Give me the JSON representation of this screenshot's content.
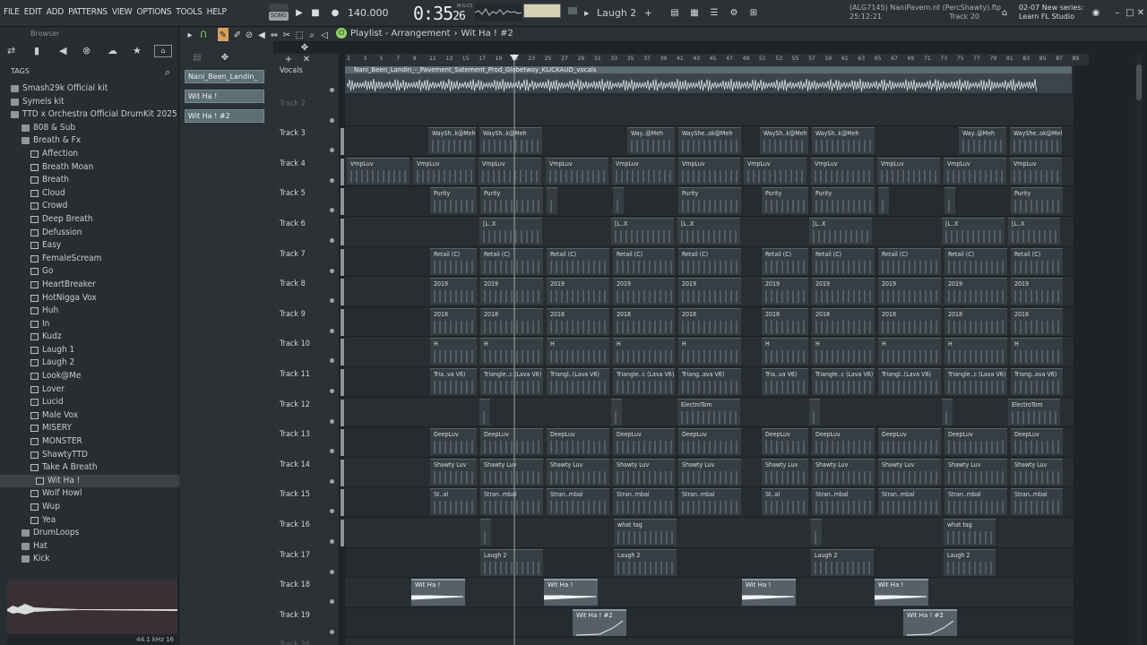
{
  "menu": [
    "FILE",
    "EDIT",
    "ADD",
    "PATTERNS",
    "VIEW",
    "OPTIONS",
    "TOOLS",
    "HELP"
  ],
  "transport": {
    "pat_label": "PAT",
    "song_label": "SONG",
    "tempo": "140.000",
    "time": "0:35",
    "time_sub": "26",
    "time_unit": "M:S:CS",
    "pattern": "Laugh 2"
  },
  "info": {
    "line1": "(ALG7145) NaniPavem.nt (PercShawty).flp",
    "line2": "25:12:21",
    "line3": "Track 20"
  },
  "news": {
    "line1": "02-07  New series:",
    "line2": "Learn FL Studio"
  },
  "browser": {
    "title": "Browser",
    "tags": "TAGS",
    "items": [
      {
        "label": "Smash29k Official kit",
        "type": "folder",
        "depth": 0
      },
      {
        "label": "Symels kit",
        "type": "folder",
        "depth": 0
      },
      {
        "label": "TTD x Orchestra Official DrumKit 2025",
        "type": "folder",
        "depth": 0
      },
      {
        "label": "808 & Sub",
        "type": "folder",
        "depth": 1
      },
      {
        "label": "Breath & Fx",
        "type": "folder",
        "depth": 1
      },
      {
        "label": "Affection",
        "type": "file",
        "depth": 2
      },
      {
        "label": "Breath Moan",
        "type": "file",
        "depth": 2
      },
      {
        "label": "Breath",
        "type": "file",
        "depth": 2
      },
      {
        "label": "Cloud",
        "type": "file",
        "depth": 2
      },
      {
        "label": "Crowd",
        "type": "file",
        "depth": 2
      },
      {
        "label": "Deep Breath",
        "type": "file",
        "depth": 2
      },
      {
        "label": "Defussion",
        "type": "file",
        "depth": 2
      },
      {
        "label": "Easy",
        "type": "file",
        "depth": 2
      },
      {
        "label": "FemaleScream",
        "type": "file",
        "depth": 2
      },
      {
        "label": "Go",
        "type": "file",
        "depth": 2
      },
      {
        "label": "HeartBreaker",
        "type": "file",
        "depth": 2
      },
      {
        "label": "HotNigga Vox",
        "type": "file",
        "depth": 2
      },
      {
        "label": "Huh",
        "type": "file",
        "depth": 2
      },
      {
        "label": "In",
        "type": "file",
        "depth": 2
      },
      {
        "label": "Kudz",
        "type": "file",
        "depth": 2
      },
      {
        "label": "Laugh 1",
        "type": "file",
        "depth": 2
      },
      {
        "label": "Laugh 2",
        "type": "file",
        "depth": 2
      },
      {
        "label": "Look@Me",
        "type": "file",
        "depth": 2
      },
      {
        "label": "Lover",
        "type": "file",
        "depth": 2
      },
      {
        "label": "Lucid",
        "type": "file",
        "depth": 2
      },
      {
        "label": "Male Vox",
        "type": "file",
        "depth": 2
      },
      {
        "label": "MISERY",
        "type": "file",
        "depth": 2
      },
      {
        "label": "MONSTER",
        "type": "file",
        "depth": 2
      },
      {
        "label": "ShawtyTTD",
        "type": "file",
        "depth": 2
      },
      {
        "label": "Take A Breath",
        "type": "file",
        "depth": 2
      },
      {
        "label": "Wit Ha !",
        "type": "file",
        "depth": 3,
        "selected": true
      },
      {
        "label": "Wolf Howl",
        "type": "file",
        "depth": 2
      },
      {
        "label": "Wup",
        "type": "file",
        "depth": 2
      },
      {
        "label": "Yea",
        "type": "file",
        "depth": 2
      },
      {
        "label": "DrumLoops",
        "type": "folder",
        "depth": 1
      },
      {
        "label": "Hat",
        "type": "folder",
        "depth": 1
      },
      {
        "label": "Kick",
        "type": "folder",
        "depth": 1
      }
    ],
    "sample_info": "44.1 kHz 16"
  },
  "playlist": {
    "title": "Playlist - Arrangement",
    "pattern": "Wit Ha ! #2",
    "patterns": [
      "Nani_Been_Landin_",
      "Wit Ha !",
      "Wit Ha ! #2"
    ],
    "ruler": [
      "1",
      "3",
      "5",
      "7",
      "9",
      "11",
      "13",
      "15",
      "17",
      "19",
      "21",
      "23",
      "25",
      "27",
      "29",
      "31",
      "33",
      "35",
      "37",
      "39",
      "41",
      "43",
      "45",
      "47",
      "49",
      "51",
      "53",
      "55",
      "57",
      "59",
      "61",
      "63",
      "65",
      "67",
      "69",
      "71",
      "73",
      "75",
      "77",
      "79",
      "81",
      "83",
      "85",
      "87",
      "89",
      "91",
      "93"
    ],
    "vocal_clip": "Nani_Been_Landin_-_Pavement_Satement_Prod_Globetwoy_KLICKAUD_vocals",
    "tracks": [
      "Vocals",
      "Track 2",
      "Track 3",
      "Track 4",
      "Track 5",
      "Track 6",
      "Track 7",
      "Track 8",
      "Track 9",
      "Track 10",
      "Track 11",
      "Track 12",
      "Track 13",
      "Track 14",
      "Track 15",
      "Track 16",
      "Track 17",
      "Track 18",
      "Track 19",
      "Track 20"
    ],
    "clips": [
      {
        "row": 2,
        "items": [
          "WaySh..k@Meh",
          "WaySh..k@Meh",
          "Way..@Meh",
          "WayShe..ok@Meh",
          "WaySh..k@Meh",
          "WaySh..k@Meh",
          "Way..@Meh",
          "WayShe..ok@Meh"
        ]
      },
      {
        "row": 3,
        "items": [
          "VmpLuv",
          "VmpLuv",
          "VmpLuv",
          "VmpLuv",
          "VmpLuv",
          "VmpLuv",
          "VmpLuv",
          "VmpLuv",
          "VmpLuv",
          "VmpLuv",
          "VmpLuv"
        ]
      },
      {
        "row": 4,
        "items": [
          "Purity",
          "Purity",
          "",
          "",
          "Purity",
          "Purity",
          "Purity",
          "",
          "",
          "Purity"
        ]
      },
      {
        "row": 5,
        "items": [
          "[L..X",
          "[L..X",
          "[L..X",
          "[L..X",
          "[L..X",
          "[L..X"
        ]
      },
      {
        "row": 6,
        "items": [
          "Retail (C)",
          "Retail (C)",
          "Retail (C)",
          "Retail (C)",
          "Retail (C)",
          "Retail (C)",
          "Retail (C)",
          "Retail (C)",
          "Retail (C)",
          "Retail (C)"
        ]
      },
      {
        "row": 7,
        "items": [
          "2019",
          "2019",
          "2019",
          "2019",
          "2019",
          "2019",
          "2019",
          "2019",
          "2019",
          "2019"
        ]
      },
      {
        "row": 8,
        "items": [
          "2018",
          "2018",
          "2018",
          "2018",
          "2018",
          "2018",
          "2018",
          "2018",
          "2018",
          "2018"
        ]
      },
      {
        "row": 9,
        "items": [
          "H",
          "H",
          "H",
          "H",
          "H",
          "H",
          "H",
          "H",
          "H",
          "H"
        ]
      },
      {
        "row": 10,
        "items": [
          "Tria..va V6)",
          "Triangle..c (Lava V6)",
          "Triangl..(Lava V6)",
          "Triangle..c (Lava V6)",
          "Triang..ava V6)",
          "Tria..va V6)",
          "Triangle..c (Lava V6)",
          "Triangl..(Lava V6)",
          "Triangle..c (Lava V6)",
          "Triang..ava V6)"
        ]
      },
      {
        "row": 11,
        "items": [
          "",
          "",
          "ElectroTom",
          "",
          "",
          "ElectroTom"
        ]
      },
      {
        "row": 12,
        "items": [
          "DeepLuv",
          "DeepLuv",
          "DeepLuv",
          "DeepLuv",
          "DeepLuv",
          "DeepLuv",
          "DeepLuv",
          "DeepLuv",
          "DeepLuv",
          "DeepLuv"
        ]
      },
      {
        "row": 13,
        "items": [
          "Shawty Luv",
          "Shawty Luv",
          "Shawty Luv",
          "Shawty Luv",
          "Shawty Luv",
          "Shawty Luv",
          "Shawty Luv",
          "Shawty Luv",
          "Shawty Luv",
          "Shawty Luv"
        ]
      },
      {
        "row": 14,
        "items": [
          "St..al",
          "Stran..mbal",
          "Stran..mbal",
          "Stran..mbal",
          "Stran..mbal",
          "St..al",
          "Stran..mbal",
          "Stran..mbal",
          "Stran..mbal",
          "Stran..mbal"
        ]
      },
      {
        "row": 15,
        "items": [
          "",
          "what tag",
          "",
          "what tag"
        ]
      },
      {
        "row": 16,
        "items": [
          "Laugh 2",
          "Laugh 2",
          "Laugh 2",
          "Laugh 2"
        ]
      },
      {
        "row": 17,
        "items": [
          "Wit Ha !",
          "Wit Ha !",
          "Wit Ha !",
          "Wit Ha !"
        ]
      },
      {
        "row": 18,
        "items": [
          "Wit Ha ! #2",
          "Wit Ha ! #2"
        ]
      }
    ]
  },
  "colors": {
    "bg": "#1e2327",
    "clip": "#363e43",
    "audio": "#566167",
    "accent": "#d8d2b4"
  }
}
